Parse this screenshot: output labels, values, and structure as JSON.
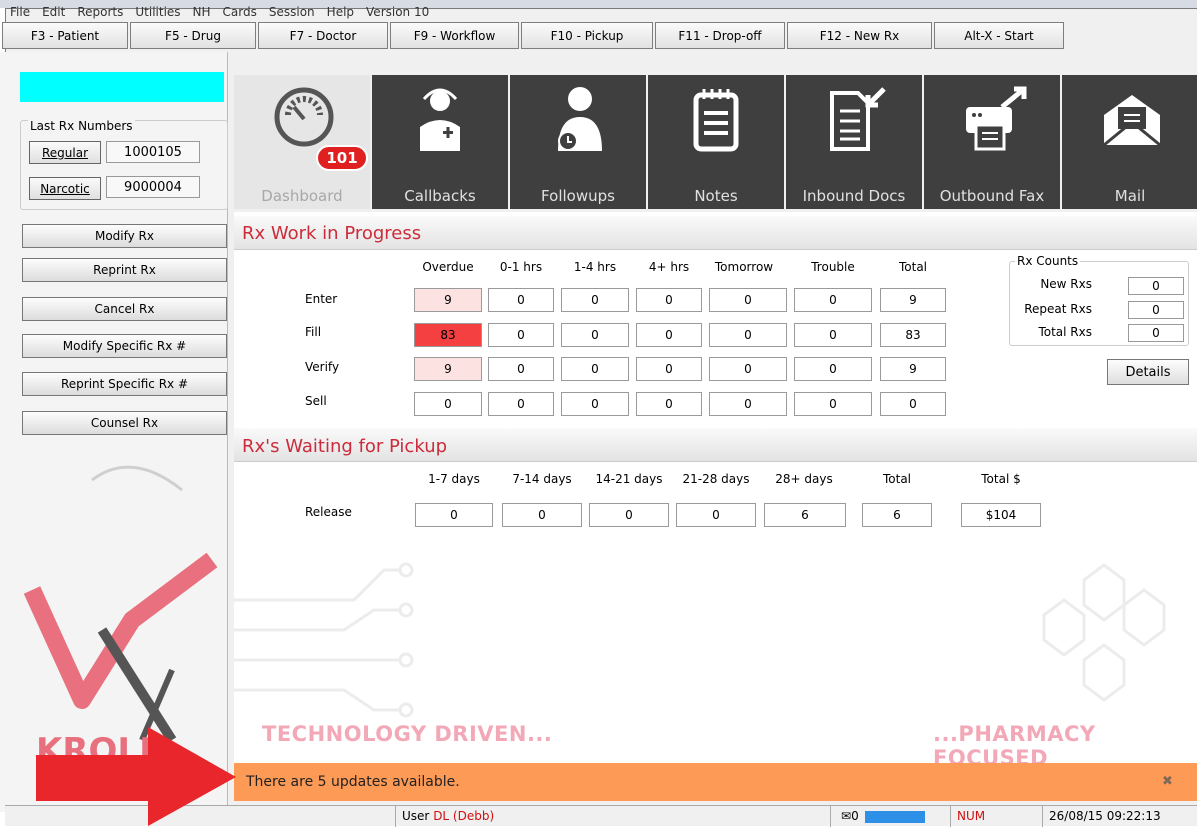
{
  "menu": [
    "File",
    "Edit",
    "Reports",
    "Utilities",
    "NH",
    "Cards",
    "Session",
    "Help",
    "Version 10"
  ],
  "fkeys": [
    {
      "label": "F3 - Patient"
    },
    {
      "label": "F5 - Drug"
    },
    {
      "label": "F7 - Doctor"
    },
    {
      "label": "F9 - Workflow"
    },
    {
      "label": "F10 - Pickup"
    },
    {
      "label": "F11 - Drop-off"
    },
    {
      "label": "F12 - New Rx"
    },
    {
      "label": "Alt-X - Start"
    }
  ],
  "last_rx": {
    "title": "Last Rx Numbers",
    "regular_label": "Regular",
    "regular_value": "1000105",
    "narcotic_label": "Narcotic",
    "narcotic_value": "9000004"
  },
  "actions": [
    "Modify Rx",
    "Reprint Rx",
    "Cancel Rx",
    "Modify Specific Rx #",
    "Reprint Specific Rx #",
    "Counsel Rx"
  ],
  "logo_text": "KROLL",
  "tiles": [
    {
      "label": "Dashboard",
      "icon": "gauge-icon"
    },
    {
      "label": "Callbacks",
      "icon": "doctor-icon"
    },
    {
      "label": "Followups",
      "icon": "person-clock-icon"
    },
    {
      "label": "Notes",
      "icon": "notepad-icon"
    },
    {
      "label": "Inbound Docs",
      "icon": "document-in-icon"
    },
    {
      "label": "Outbound Fax",
      "icon": "fax-icon"
    },
    {
      "label": "Mail",
      "icon": "envelope-icon"
    }
  ],
  "badge": "101",
  "wip": {
    "title": "Rx Work in Progress",
    "columns": [
      "Overdue",
      "0-1 hrs",
      "1-4 hrs",
      "4+ hrs",
      "Tomorrow",
      "Trouble",
      "Total"
    ],
    "rows": [
      {
        "label": "Enter",
        "values": [
          "9",
          "0",
          "0",
          "0",
          "0",
          "0",
          "9"
        ]
      },
      {
        "label": "Fill",
        "values": [
          "83",
          "0",
          "0",
          "0",
          "0",
          "0",
          "83"
        ]
      },
      {
        "label": "Verify",
        "values": [
          "9",
          "0",
          "0",
          "0",
          "0",
          "0",
          "9"
        ]
      },
      {
        "label": "Sell",
        "values": [
          "0",
          "0",
          "0",
          "0",
          "0",
          "0",
          "0"
        ]
      }
    ]
  },
  "counts": {
    "title": "Rx Counts",
    "items": [
      {
        "label": "New Rxs",
        "value": "0"
      },
      {
        "label": "Repeat Rxs",
        "value": "0"
      },
      {
        "label": "Total Rxs",
        "value": "0"
      }
    ],
    "details": "Details"
  },
  "pickup": {
    "title": "Rx's Waiting for Pickup",
    "columns": [
      "1-7 days",
      "7-14 days",
      "14-21 days",
      "21-28 days",
      "28+ days",
      "Total",
      "Total $"
    ],
    "row": {
      "label": "Release",
      "values": [
        "0",
        "0",
        "0",
        "0",
        "6",
        "6",
        "$104"
      ]
    }
  },
  "watermark": {
    "left": "TECHNOLOGY DRIVEN...",
    "right": "...PHARMACY FOCUSED"
  },
  "update": {
    "text": "There are 5 updates available.",
    "close": "✖"
  },
  "status": {
    "user_prefix": "User",
    "user": "DL (Debb)",
    "mail_count": "0",
    "num": "NUM",
    "datetime": "26/08/15  09:22:13"
  },
  "colors": {
    "accent": "#cc2b3b",
    "update_bar": "#fd9a55",
    "overdue_light": "#fde2e2",
    "overdue_hot": "#f44040",
    "tile_dark": "#3f3f3f"
  }
}
